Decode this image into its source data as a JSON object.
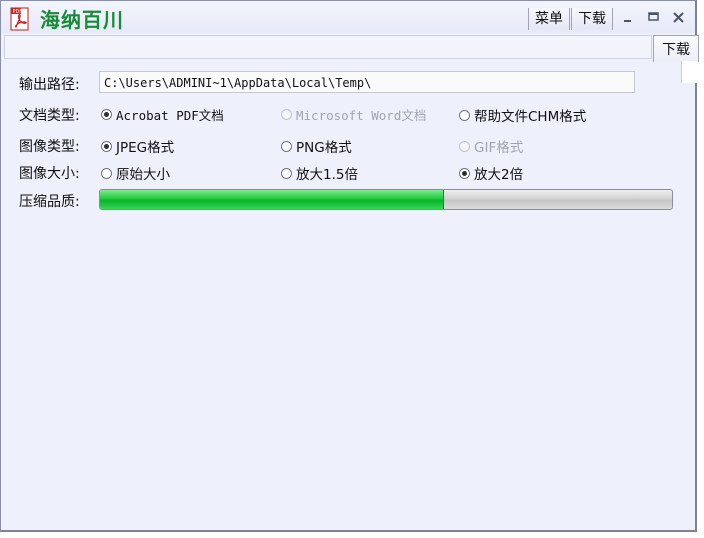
{
  "titlebar": {
    "app_title": "海纳百川",
    "logo_icon": "pdf-icon",
    "menu_label": "菜单",
    "download_label": "下载",
    "minimize_icon": "minimize-icon",
    "maximize_icon": "maximize-icon",
    "close_icon": "close-icon"
  },
  "side_tab": {
    "label": "下载"
  },
  "form": {
    "output_path_label": "输出路径:",
    "output_path_value": "C:\\Users\\ADMINI~1\\AppData\\Local\\Temp\\",
    "doc_type_label": "文档类型:",
    "doc_types": [
      {
        "label": "Acrobat PDF文档",
        "selected": true,
        "enabled": true
      },
      {
        "label": "Microsoft Word文档",
        "selected": false,
        "enabled": false
      },
      {
        "label": "帮助文件CHM格式",
        "selected": false,
        "enabled": true
      }
    ],
    "image_type_label": "图像类型:",
    "image_types": [
      {
        "label": "JPEG格式",
        "selected": true,
        "enabled": true
      },
      {
        "label": "PNG格式",
        "selected": false,
        "enabled": true
      },
      {
        "label": "GIF格式",
        "selected": false,
        "enabled": false
      }
    ],
    "image_size_label": "图像大小:",
    "image_sizes": [
      {
        "label": "原始大小",
        "selected": false,
        "enabled": true
      },
      {
        "label": "放大1.5倍",
        "selected": false,
        "enabled": true
      },
      {
        "label": "放大2倍",
        "selected": true,
        "enabled": true
      }
    ],
    "quality_label": "压缩品质:",
    "quality_fraction": 0.6
  },
  "colors": {
    "title_green": "#1a8a3a",
    "window_bg": "#eef0fb",
    "progress_green": "#08b52a"
  }
}
